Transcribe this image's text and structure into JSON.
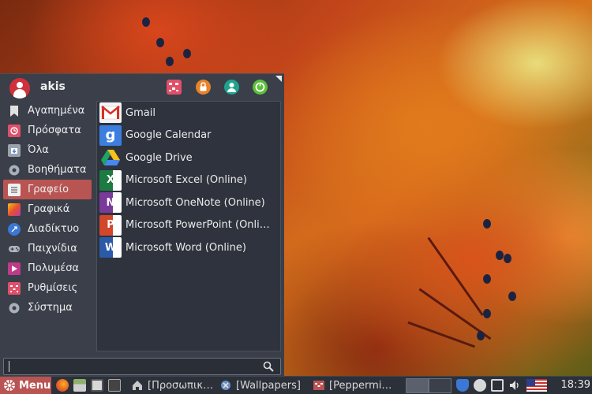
{
  "menu": {
    "username": "akis",
    "header_buttons": [
      "settings-icon",
      "lock-icon",
      "user-switch-icon",
      "logout-icon"
    ],
    "categories": [
      {
        "label": "Αγαπημένα",
        "icon": "bookmark-icon"
      },
      {
        "label": "Πρόσφατα",
        "icon": "recent-icon"
      },
      {
        "label": "Όλα",
        "icon": "all-apps-icon"
      },
      {
        "label": "Βοηθήματα",
        "icon": "accessories-icon"
      },
      {
        "label": "Γραφείο",
        "icon": "office-icon",
        "active": true
      },
      {
        "label": "Γραφικά",
        "icon": "graphics-icon"
      },
      {
        "label": "Διαδίκτυο",
        "icon": "internet-icon"
      },
      {
        "label": "Παιχνίδια",
        "icon": "games-icon"
      },
      {
        "label": "Πολυμέσα",
        "icon": "multimedia-icon"
      },
      {
        "label": "Ρυθμίσεις",
        "icon": "settings-icon"
      },
      {
        "label": "Σύστημα",
        "icon": "system-icon"
      }
    ],
    "apps": [
      {
        "label": "Gmail",
        "icon": "gmail-icon"
      },
      {
        "label": "Google Calendar",
        "icon": "google-calendar-icon"
      },
      {
        "label": "Google Drive",
        "icon": "google-drive-icon"
      },
      {
        "label": "Microsoft Excel (Online)",
        "icon": "excel-icon"
      },
      {
        "label": "Microsoft OneNote (Online)",
        "icon": "onenote-icon"
      },
      {
        "label": "Microsoft PowerPoint (Onli…",
        "icon": "powerpoint-icon"
      },
      {
        "label": "Microsoft Word (Online)",
        "icon": "word-icon"
      }
    ],
    "search_value": ""
  },
  "panel": {
    "menu_label": "Menu",
    "tasks": [
      {
        "label": "[Προσωπικ…",
        "icon": "home-folder-icon"
      },
      {
        "label": "[Wallpapers]",
        "icon": "wallpapers-icon"
      },
      {
        "label": "[Peppermi…",
        "icon": "peppermint-icon"
      }
    ],
    "clock": "18:39"
  },
  "colors": {
    "accent": "#b85452",
    "menu_bg": "#3a3f4a",
    "panel_bg": "#2c3039"
  }
}
